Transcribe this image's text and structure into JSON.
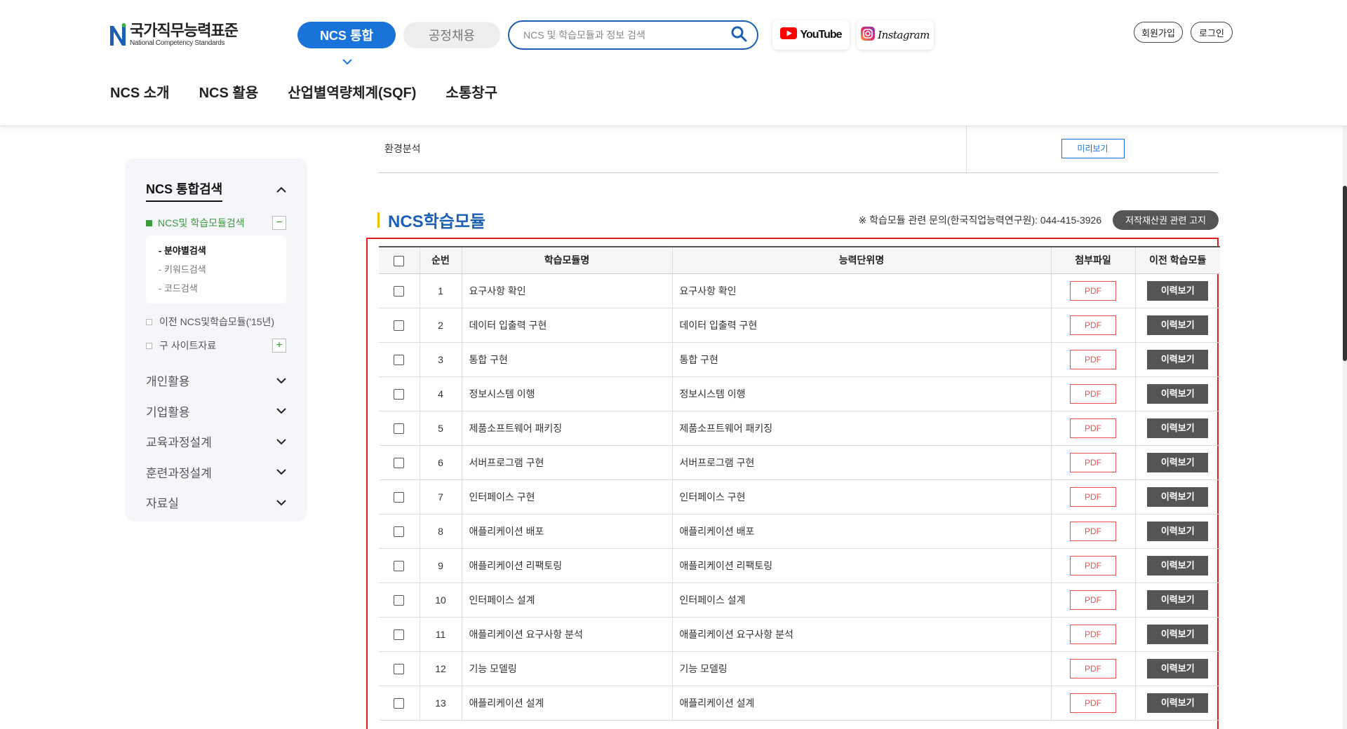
{
  "header": {
    "logo_ko": "국가직무능력표준",
    "logo_en": "National Competency Standards",
    "btn_ncs": "NCS 통합",
    "btn_open": "공정채용",
    "search_placeholder": "NCS 및 학습모듈과 정보 검색",
    "youtube": "YouTube",
    "instagram": "Instagram",
    "join": "회원가입",
    "login": "로그인",
    "gnb": [
      "NCS 소개",
      "NCS 활용",
      "산업별역량체계(SQF)",
      "소통창구"
    ]
  },
  "sidebar": {
    "title": "NCS 통합검색",
    "sub": "NCS및 학습모듈검색",
    "subitems": [
      "- 분야별검색",
      "- 키워드검색",
      "- 코드검색"
    ],
    "prev": "이전 NCS및학습모듈('15년)",
    "old": "구 사이트자료",
    "menu": [
      "개인활용",
      "기업활용",
      "교육과정설계",
      "훈련과정설계",
      "자료실"
    ]
  },
  "top_table": {
    "row_name": "환경분석",
    "preview": "미리보기"
  },
  "section": {
    "title": "NCS학습모듈",
    "inquiry": "※ 학습모듈 관련 문의(한국직업능력연구원): 044-415-3926",
    "copyright": "저작재산권 관련 고지"
  },
  "table": {
    "headers": [
      "순번",
      "학습모듈명",
      "능력단위명",
      "첨부파일",
      "이전 학습모듈"
    ],
    "pdf": "PDF",
    "history": "이력보기",
    "rows": [
      {
        "no": "1",
        "name": "요구사항 확인",
        "unit": "요구사항 확인"
      },
      {
        "no": "2",
        "name": "데이터 입출력 구현",
        "unit": "데이터 입출력 구현"
      },
      {
        "no": "3",
        "name": "통합 구현",
        "unit": "통합 구현"
      },
      {
        "no": "4",
        "name": "정보시스템 이행",
        "unit": "정보시스템 이행"
      },
      {
        "no": "5",
        "name": "제품소프트웨어 패키징",
        "unit": "제품소프트웨어 패키징"
      },
      {
        "no": "6",
        "name": "서버프로그램 구현",
        "unit": "서버프로그램 구현"
      },
      {
        "no": "7",
        "name": "인터페이스 구현",
        "unit": "인터페이스 구현"
      },
      {
        "no": "8",
        "name": "애플리케이션 배포",
        "unit": "애플리케이션 배포"
      },
      {
        "no": "9",
        "name": "애플리케이션 리팩토링",
        "unit": "애플리케이션 리팩토링"
      },
      {
        "no": "10",
        "name": "인터페이스 설계",
        "unit": "인터페이스 설계"
      },
      {
        "no": "11",
        "name": "애플리케이션 요구사항 분석",
        "unit": "애플리케이션 요구사항 분석"
      },
      {
        "no": "12",
        "name": "기능 모델링",
        "unit": "기능 모델링"
      },
      {
        "no": "13",
        "name": "애플리케이션 설계",
        "unit": "애플리케이션 설계"
      }
    ]
  },
  "colors": {
    "primary": "#1a73d9",
    "highlight_border": "#e02020",
    "pdf": "#e85050",
    "history_btn": "#555555",
    "sidebar_green": "#3b9a3b"
  }
}
